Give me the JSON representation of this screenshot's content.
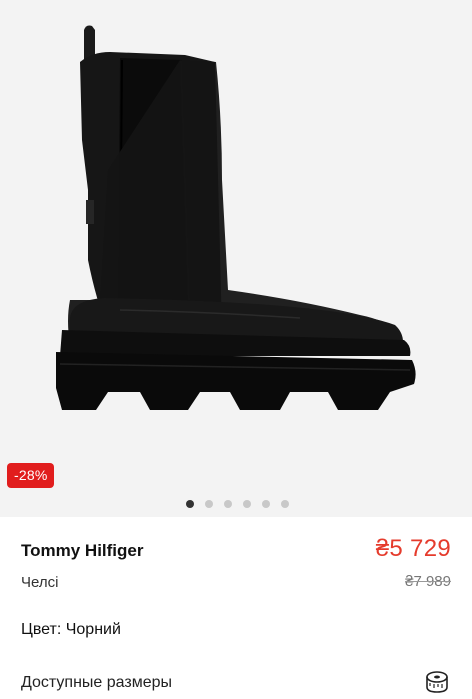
{
  "gallery": {
    "discount_badge": "-28%",
    "pages_total": 6,
    "page_active": 1
  },
  "product": {
    "brand": "Tommy Hilfiger",
    "category": "Челсі",
    "price_now": "₴5 729",
    "price_old": "₴7 989",
    "color_label": "Цвет: Чорний",
    "sizes_label": "Доступные размеры"
  },
  "icons": {
    "size_guide": "measuring-tape-icon"
  },
  "colors": {
    "accent_red": "#e11d1d",
    "price_red": "#e53b2c"
  }
}
